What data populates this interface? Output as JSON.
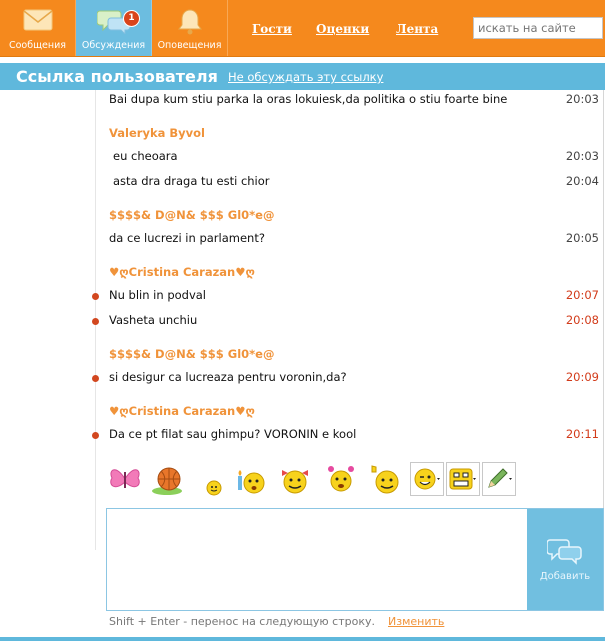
{
  "nav": {
    "tiles": [
      {
        "label": "Сообщения",
        "icon": "envelope-icon"
      },
      {
        "label": "Обсуждения",
        "icon": "chat-bubbles-icon",
        "badge": "1"
      },
      {
        "label": "Оповещения",
        "icon": "bell-icon"
      }
    ],
    "links": [
      "Гости",
      "Оценки",
      "Лента"
    ],
    "search_placeholder": "искать на сайте"
  },
  "header": {
    "title": "Ссылка пользователя",
    "action_link": "Не обсуждать эту ссылку"
  },
  "messages": [
    {
      "text": "Bai dupa kum stiu parka la oras lokuiesk,da politika o stiu foarte bine",
      "time": "20:03"
    },
    {
      "author": "Valeryka Byvol"
    },
    {
      "text": "eu cheoara",
      "time": "20:03"
    },
    {
      "text": "asta dra draga tu esti chior",
      "time": "20:04"
    },
    {
      "author": "$$$$& D@N& $$$ Gl0*e@"
    },
    {
      "text": "da ce lucrezi in parlament?",
      "time": "20:05"
    },
    {
      "author": "♥ღCristina Carazan♥ღ"
    },
    {
      "text": "Nu blin in podval",
      "time": "20:07",
      "unread": true
    },
    {
      "text": "Vasheta unchiu",
      "time": "20:08",
      "unread": true
    },
    {
      "author": "$$$$& D@N& $$$ Gl0*e@"
    },
    {
      "text": "si desigur ca lucreaza pentru voronin,da?",
      "time": "20:09",
      "unread": true
    },
    {
      "author": "♥ღCristina Carazan♥ღ"
    },
    {
      "text": "Da ce pt filat sau ghimpu? VORONIN e kool",
      "time": "20:11",
      "unread": true
    }
  ],
  "smileys": [
    "butterfly-icon",
    "basketball-icon",
    "small-smiley-icon",
    "candle-smiley-icon",
    "bow-smiley-icon",
    "pigtails-smiley-icon",
    "thumbsup-smiley-icon",
    "wink-smiley-dropdown-icon",
    "grin-smiley-dropdown-icon",
    "pencil-dropdown-icon"
  ],
  "composer": {
    "value": "",
    "send_label": "Добавить",
    "hint": "Shift + Enter - перенос на следующую строку.",
    "hint_link": "Изменить"
  },
  "colors": {
    "orange": "#f5891d",
    "blue": "#5fb8dc",
    "author": "#f0933a",
    "unread_time": "#d23b1a"
  }
}
